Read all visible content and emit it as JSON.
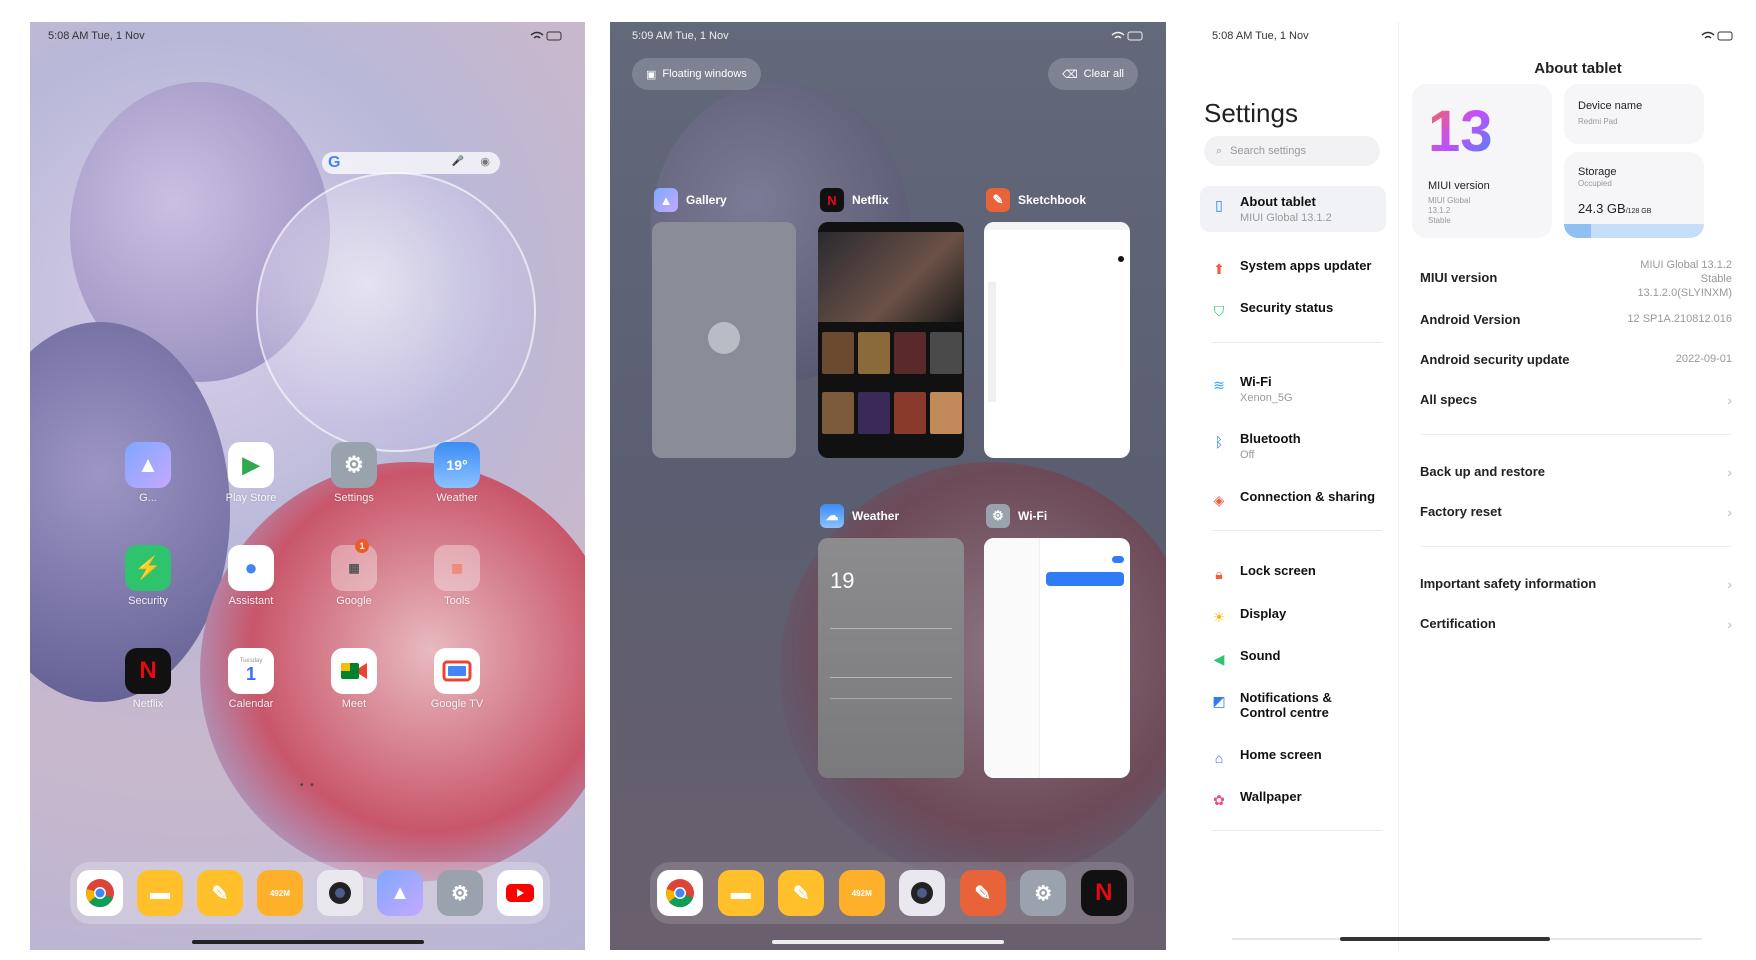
{
  "home": {
    "status_time": "5:08 AM  Tue, 1 Nov",
    "status_icons": "wifi battery",
    "search": {
      "logo": "G",
      "mic": "🎤",
      "lens": "◉"
    },
    "apps_row1": [
      {
        "label": "G...",
        "icon": "gallery-icon"
      },
      {
        "label": "Play Store",
        "icon": "play-store-icon"
      },
      {
        "label": "Settings",
        "icon": "settings-icon"
      },
      {
        "label": "Weather",
        "icon": "weather-icon",
        "text": "19°"
      }
    ],
    "apps_row2": [
      {
        "label": "Security",
        "icon": "security-icon"
      },
      {
        "label": "Assistant",
        "icon": "assistant-icon"
      },
      {
        "label": "Google",
        "icon": "google-folder-icon",
        "badge": "1"
      },
      {
        "label": "Tools",
        "icon": "tools-folder-icon"
      }
    ],
    "apps_row3": [
      {
        "label": "Netflix",
        "icon": "netflix-icon",
        "text": "N"
      },
      {
        "label": "Calendar",
        "icon": "calendar-icon",
        "text": "1",
        "sub": "Tuesday"
      },
      {
        "label": "Meet",
        "icon": "meet-icon"
      },
      {
        "label": "Google TV",
        "icon": "google-tv-icon"
      }
    ],
    "page_dots": "• •",
    "dock": [
      "chrome-icon",
      "files-icon",
      "notes-icon",
      "cleaner-icon",
      "camera-icon",
      "gallery-icon",
      "settings-icon",
      "youtube-icon"
    ],
    "cleaner_text": "492M"
  },
  "recents": {
    "status_time": "5:09 AM  Tue, 1 Nov",
    "floating_windows": "Floating windows",
    "clear_all": "Clear all",
    "cards": [
      {
        "title": "Gallery"
      },
      {
        "title": "Netflix"
      },
      {
        "title": "Sketchbook"
      },
      {
        "title": "Weather"
      },
      {
        "title": "Wi-Fi"
      }
    ],
    "weather_temp": "19",
    "dock": [
      "chrome-icon",
      "files-icon",
      "notes-icon",
      "cleaner-icon",
      "camera-icon",
      "sketchbook-icon",
      "settings-icon",
      "netflix-icon"
    ],
    "cleaner_text": "492M"
  },
  "settings": {
    "status_time": "5:08 AM  Tue, 1 Nov",
    "title": "Settings",
    "search_placeholder": "Search settings",
    "items": [
      {
        "title": "About tablet",
        "sub": "MIUI Global 13.1.2",
        "icon": "tablet-icon",
        "color": "#2f7cf6"
      },
      {
        "title": "System apps updater",
        "sub": "",
        "icon": "arrow-up-icon",
        "color": "#f25c3a"
      },
      {
        "title": "Security status",
        "sub": "",
        "icon": "shield-check-icon",
        "color": "#2ec46d"
      },
      {
        "title": "Wi-Fi",
        "sub": "Xenon_5G",
        "icon": "wifi-icon",
        "color": "#2f9cf6"
      },
      {
        "title": "Bluetooth",
        "sub": "Off",
        "icon": "bluetooth-icon",
        "color": "#2f7cf6"
      },
      {
        "title": "Connection & sharing",
        "sub": "",
        "icon": "connection-icon",
        "color": "#f25c3a"
      },
      {
        "title": "Lock screen",
        "sub": "",
        "icon": "lock-icon",
        "color": "#f25c3a"
      },
      {
        "title": "Display",
        "sub": "",
        "icon": "sun-icon",
        "color": "#f5b90e"
      },
      {
        "title": "Sound",
        "sub": "",
        "icon": "speaker-icon",
        "color": "#2ec46d"
      },
      {
        "title": "Notifications & Control centre",
        "sub": "",
        "icon": "notification-icon",
        "color": "#2f7cf6"
      },
      {
        "title": "Home screen",
        "sub": "",
        "icon": "home-icon",
        "color": "#5c6bf0"
      },
      {
        "title": "Wallpaper",
        "sub": "",
        "icon": "flower-icon",
        "color": "#f2487a"
      }
    ],
    "about": {
      "title": "About tablet",
      "logo_text": "13",
      "miui_tile_title": "MIUI version",
      "miui_tile_lines": [
        "MIUI Global",
        "13.1.2",
        "Stable"
      ],
      "device_name_label": "Device name",
      "device_name_value": "Redmi Pad",
      "storage_label": "Storage",
      "storage_sub": "Occupied",
      "storage_used": "24.3 GB",
      "storage_total": "/128 GB",
      "storage_fraction": 0.19,
      "rows": [
        {
          "key": "MIUI version",
          "value": "MIUI Global 13.1.2\nStable\n13.1.2.0(SLYINXM)"
        },
        {
          "key": "Android Version",
          "value": "12 SP1A.210812.016"
        },
        {
          "key": "Android security update",
          "value": "2022-09-01"
        },
        {
          "key": "All specs",
          "value": ""
        },
        {
          "key": "Back up and restore",
          "value": ""
        },
        {
          "key": "Factory reset",
          "value": ""
        },
        {
          "key": "Important safety information",
          "value": ""
        },
        {
          "key": "Certification",
          "value": ""
        }
      ]
    }
  }
}
